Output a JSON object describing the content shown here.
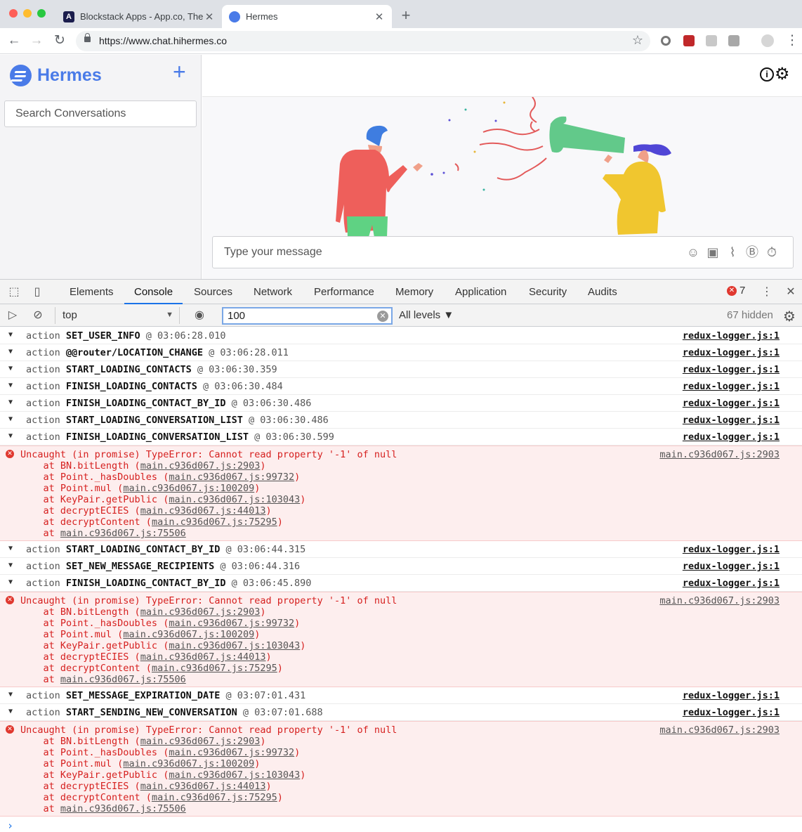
{
  "browser": {
    "tabs": [
      {
        "title": "Blockstack Apps - App.co, The",
        "favicon": "A"
      },
      {
        "title": "Hermes"
      }
    ],
    "url": "https://www.chat.hihermes.co"
  },
  "app": {
    "brand": "Hermes",
    "search_placeholder": "Search Conversations",
    "message_placeholder": "Type your message",
    "accent": "#4a7be8"
  },
  "devtools": {
    "tabs": [
      "Elements",
      "Console",
      "Sources",
      "Network",
      "Performance",
      "Memory",
      "Application",
      "Security",
      "Audits"
    ],
    "active_tab": "Console",
    "error_count": "7",
    "context": "top",
    "filter": "100",
    "levels": "All levels ▼",
    "hidden": "67 hidden"
  },
  "console": {
    "block1": [
      {
        "label": "action",
        "type": "SET_USER_INFO",
        "time": "@ 03:06:28.010",
        "src": "redux-logger.js:1"
      },
      {
        "label": "action",
        "type": "@@router/LOCATION_CHANGE",
        "time": "@ 03:06:28.011",
        "src": "redux-logger.js:1"
      },
      {
        "label": "action",
        "type": "START_LOADING_CONTACTS",
        "time": "@ 03:06:30.359",
        "src": "redux-logger.js:1"
      },
      {
        "label": "action",
        "type": "FINISH_LOADING_CONTACTS",
        "time": "@ 03:06:30.484",
        "src": "redux-logger.js:1"
      },
      {
        "label": "action",
        "type": "FINISH_LOADING_CONTACT_BY_ID",
        "time": "@ 03:06:30.486",
        "src": "redux-logger.js:1"
      },
      {
        "label": "action",
        "type": "START_LOADING_CONVERSATION_LIST",
        "time": "@ 03:06:30.486",
        "src": "redux-logger.js:1"
      },
      {
        "label": "action",
        "type": "FINISH_LOADING_CONVERSATION_LIST",
        "time": "@ 03:06:30.599",
        "src": "redux-logger.js:1"
      }
    ],
    "block2": [
      {
        "label": "action",
        "type": "START_LOADING_CONTACT_BY_ID",
        "time": "@ 03:06:44.315",
        "src": "redux-logger.js:1"
      },
      {
        "label": "action",
        "type": "SET_NEW_MESSAGE_RECIPIENTS",
        "time": "@ 03:06:44.316",
        "src": "redux-logger.js:1"
      },
      {
        "label": "action",
        "type": "FINISH_LOADING_CONTACT_BY_ID",
        "time": "@ 03:06:45.890",
        "src": "redux-logger.js:1"
      }
    ],
    "block3": [
      {
        "label": "action",
        "type": "SET_MESSAGE_EXPIRATION_DATE",
        "time": "@ 03:07:01.431",
        "src": "redux-logger.js:1"
      },
      {
        "label": "action",
        "type": "START_SENDING_NEW_CONVERSATION",
        "time": "@ 03:07:01.688",
        "src": "redux-logger.js:1"
      }
    ],
    "error": {
      "message": "Uncaught (in promise) TypeError: Cannot read property '-1' of null",
      "src": "main.c936d067.js:2903",
      "stack": [
        {
          "fn": "at BN.bitLength (",
          "loc": "main.c936d067.js:2903",
          "end": ")"
        },
        {
          "fn": "at Point._hasDoubles (",
          "loc": "main.c936d067.js:99732",
          "end": ")"
        },
        {
          "fn": "at Point.mul (",
          "loc": "main.c936d067.js:100209",
          "end": ")"
        },
        {
          "fn": "at KeyPair.getPublic (",
          "loc": "main.c936d067.js:103043",
          "end": ")"
        },
        {
          "fn": "at decryptECIES (",
          "loc": "main.c936d067.js:44013",
          "end": ")"
        },
        {
          "fn": "at decryptContent (",
          "loc": "main.c936d067.js:75295",
          "end": ")"
        },
        {
          "fn": "at ",
          "loc": "main.c936d067.js:75506",
          "end": ""
        }
      ]
    }
  }
}
